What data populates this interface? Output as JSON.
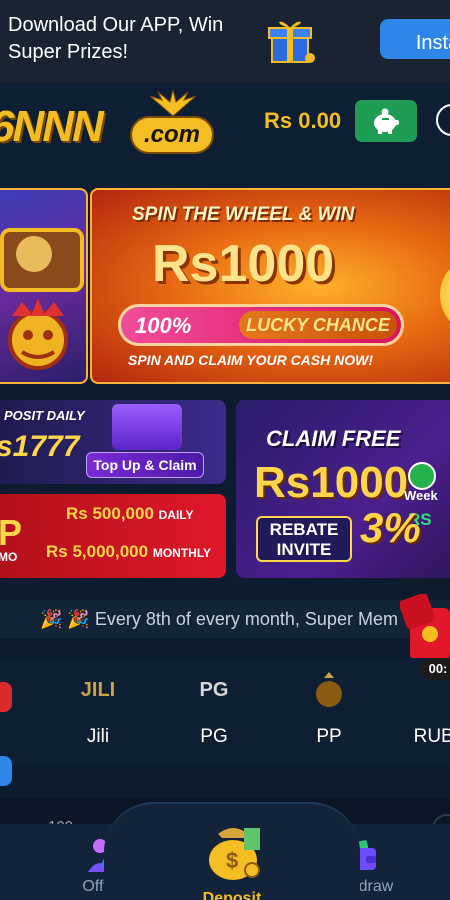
{
  "download_banner": {
    "text": "Download Our APP, Win Super Prizes!",
    "install_label": "Insta"
  },
  "header": {
    "logo_main": "6NNN",
    "logo_suffix": ".com",
    "balance": "Rs 0.00"
  },
  "hero": {
    "title": "SPIN THE WHEEL & WIN",
    "amount": "Rs1000",
    "pill_percent": "100%",
    "pill_label": "LUCKY CHANCE",
    "subtitle": "SPIN AND CLAIM YOUR CASH NOW!"
  },
  "promos": {
    "deposit_daily": "POSIT DAILY",
    "deposit_amount": "s1777",
    "topup_button": "Top Up & Claim",
    "p2_left": "P",
    "p2_left_sub": "MO",
    "daily_amount": "Rs 500,000",
    "daily_label": "DAILY",
    "monthly_amount": "Rs 5,000,000",
    "monthly_label": "MONTHLY",
    "claim_free": "CLAIM FREE",
    "claim_amount": "Rs1000",
    "rebate_label": "REBATE INVITE",
    "rebate_percent": "3%",
    "weekly_label": "Week",
    "rs_label": "RS"
  },
  "marquee": {
    "text": "🎉 🎉 Every 8th of every month, Super Mem"
  },
  "providers": [
    {
      "logo": "JILI",
      "name": "Jili",
      "color": "#c9a44b"
    },
    {
      "logo": "PG",
      "name": "PG",
      "color": "#d6d6d6"
    },
    {
      "logo": "P.M",
      "name": "PP",
      "color": "#c9a44b"
    },
    {
      "logo": "",
      "name": "RUBY",
      "color": "#ffffff"
    }
  ],
  "envelope": {
    "timer": "00:"
  },
  "bottom_nav": {
    "partial_count": "100",
    "offers_label": "Offers",
    "deposit_label": "Deposit",
    "withdraw_label": "Withdraw"
  }
}
